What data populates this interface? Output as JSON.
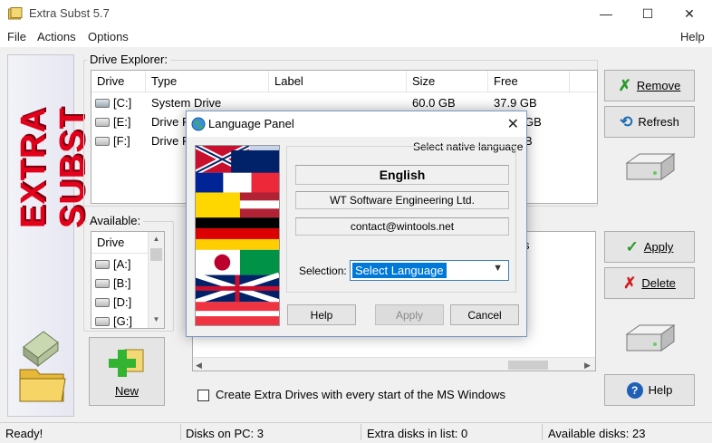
{
  "window": {
    "title": "Extra Subst 5.7",
    "minimize_glyph": "—",
    "maximize_glyph": "☐",
    "close_glyph": "✕"
  },
  "menu": {
    "file": "File",
    "actions": "Actions",
    "options": "Options",
    "help": "Help"
  },
  "banner": {
    "text": "EXTRA SUBST",
    "color": "#e2001a"
  },
  "drive_explorer": {
    "label": "Drive Explorer:",
    "columns": [
      "Drive",
      "Type",
      "Label",
      "Size",
      "Free"
    ],
    "rows": [
      {
        "drive": "[C:]",
        "type": "System Drive",
        "label": "",
        "size": "60.0 GB",
        "free": "37.9 GB",
        "icon": "system-drive-icon"
      },
      {
        "drive": "[E:]",
        "type": "Drive F",
        "label": "",
        "size": "",
        "free": "GB",
        "icon": "drive-icon"
      },
      {
        "drive": "[F:]",
        "type": "Drive F",
        "label": "",
        "size": "",
        "free": "B",
        "icon": "drive-icon"
      }
    ]
  },
  "buttons": {
    "remove": "Remove",
    "refresh": "Refresh",
    "apply": "Apply",
    "delete": "Delete",
    "help": "Help",
    "new": "New"
  },
  "available": {
    "label": "Available:",
    "column": "Drive",
    "items": [
      "[A:]",
      "[B:]",
      "[D:]",
      "[G:]"
    ]
  },
  "extra_list": {
    "partial_text": "s"
  },
  "checkbox": {
    "label": "Create Extra Drives with every start of the MS Windows",
    "checked": false
  },
  "status": {
    "ready": "Ready!",
    "disks_on_pc": "Disks on PC: 3",
    "extra_disks": "Extra disks in list: 0",
    "available_disks": "Available disks: 23"
  },
  "dialog": {
    "title": "Language Panel",
    "caption": "Select native language",
    "language": "English",
    "company": "WT Software Engineering Ltd.",
    "contact": "contact@wintools.net",
    "selection_label": "Selection:",
    "selection_value": "Select Language",
    "help": "Help",
    "apply": "Apply",
    "cancel": "Cancel"
  },
  "colors": {
    "accent_blue": "#0078d7",
    "apply_green": "#2a9a2a",
    "delete_red": "#d02020",
    "new_plus_green": "#32b432"
  }
}
